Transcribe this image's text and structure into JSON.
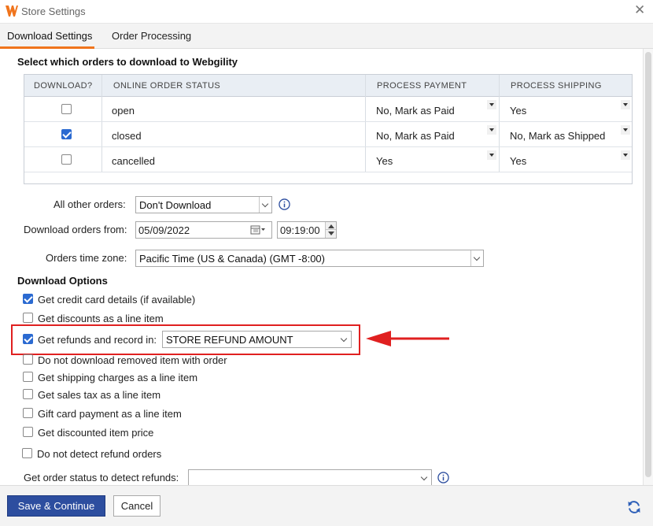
{
  "window": {
    "title": "Store Settings",
    "logo_icon": "webgility-logo-icon",
    "close_icon": "close-icon",
    "close_glyph": "✕"
  },
  "tabs": [
    {
      "label": "Download Settings",
      "active": true
    },
    {
      "label": "Order Processing",
      "active": false
    }
  ],
  "orders_section": {
    "title": "Select which orders to download to Webgility",
    "columns": [
      "DOWNLOAD?",
      "ONLINE ORDER STATUS",
      "PROCESS PAYMENT",
      "PROCESS SHIPPING"
    ],
    "rows": [
      {
        "download": false,
        "status": "open",
        "payment": "No, Mark as Paid",
        "shipping": "Yes"
      },
      {
        "download": true,
        "status": "closed",
        "payment": "No, Mark as Paid",
        "shipping": "No, Mark as Shipped"
      },
      {
        "download": false,
        "status": "cancelled",
        "payment": "Yes",
        "shipping": "Yes"
      }
    ]
  },
  "filters": {
    "all_other_orders_label": "All other orders:",
    "all_other_orders_value": "Don't Download",
    "download_from_label": "Download orders from:",
    "download_from_date": "05/09/2022",
    "download_from_time": "09:19:00",
    "timezone_label": "Orders time zone:",
    "timezone_value": "Pacific Time (US & Canada) (GMT -8:00)"
  },
  "download_options": {
    "title": "Download Options",
    "credit_card": {
      "label": "Get credit card details (if available)",
      "checked": true
    },
    "discounts": {
      "label": "Get discounts as a line item",
      "checked": false
    },
    "refunds": {
      "label": "Get refunds and record in:",
      "checked": true,
      "select_value": "STORE REFUND AMOUNT"
    },
    "removed_item": {
      "label": "Do not download removed item with order",
      "checked": false
    },
    "shipping": {
      "label": "Get shipping charges as a line item",
      "checked": false
    },
    "sales_tax": {
      "label": "Get sales tax as a line item",
      "checked": false
    },
    "gift_card": {
      "label": "Gift card payment as a line item",
      "checked": false
    },
    "discounted_price": {
      "label": "Get discounted item price",
      "checked": false
    },
    "detect_refund": {
      "label": "Do not detect refund orders",
      "checked": false
    },
    "refund_status_label": "Get order status to detect refunds:",
    "refund_status_value": ""
  },
  "footer": {
    "save_label": "Save & Continue",
    "cancel_label": "Cancel",
    "refresh_icon": "refresh-icon"
  },
  "colors": {
    "accent_tab": "#f0741c",
    "primary_button": "#2d4e9f",
    "checkbox_checked": "#2b6ad1",
    "annotation_red": "#e02020"
  }
}
